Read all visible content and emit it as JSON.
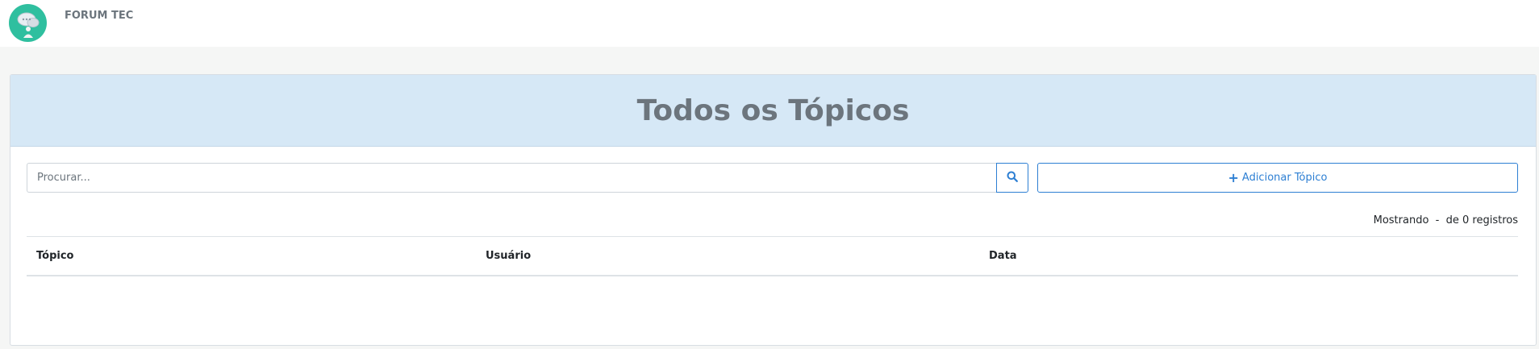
{
  "navbar": {
    "brand": "FORUM TEC",
    "logo_icon": "chat-bubbles-logo-icon",
    "accent_color": "#2fbf9f"
  },
  "card": {
    "title": "Todos os Tópicos",
    "header_color": "#d6e8f6"
  },
  "search": {
    "placeholder": "Procurar...",
    "value": "",
    "button_icon": "search-icon"
  },
  "add_button": {
    "icon": "plus-icon",
    "label": "Adicionar Tópico",
    "color": "#2d7fd3"
  },
  "records": {
    "text": "Mostrando  -  de 0 registros"
  },
  "table": {
    "columns": [
      "Tópico",
      "Usuário",
      "Data"
    ],
    "rows": []
  }
}
